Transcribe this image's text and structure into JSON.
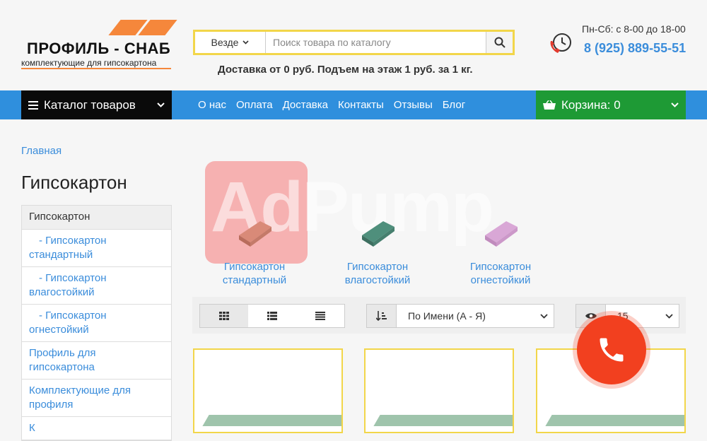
{
  "logo": {
    "title": "ПРОФИЛЬ - СНАБ",
    "subtitle": "комплектующие для гипсокартона"
  },
  "search": {
    "scope": "Везде",
    "placeholder": "Поиск товара по каталогу"
  },
  "delivery_text": "Доставка от 0 руб. Подъем на этаж 1 руб. за 1 кг.",
  "contacts": {
    "hours": "Пн-Сб: с 8-00 до 18-00",
    "phone": "8 (925) 889-55-51"
  },
  "nav": {
    "catalog_label": "Каталог товаров",
    "links": [
      "О нас",
      "Оплата",
      "Доставка",
      "Контакты",
      "Отзывы",
      "Блог"
    ],
    "cart_label": "Корзина: 0"
  },
  "breadcrumb": "Главная",
  "page_title": "Гипсокартон",
  "sidebar": {
    "header": "Гипсокартон",
    "items": [
      "- Гипсокартон стандартный",
      "- Гипсокартон влагостойкий",
      "- Гипсокартон огнестойкий",
      "Профиль для гипсокартона",
      "Комплектующие для профиля",
      "К"
    ]
  },
  "categories": [
    {
      "label": "Гипсокартон стандартный",
      "color": "#d98a78"
    },
    {
      "label": "Гипсокартон влагостойкий",
      "color": "#4f8f7c"
    },
    {
      "label": "Гипсокартон огнестойкий",
      "color": "#d9a7d6"
    }
  ],
  "watermark": "AdPump",
  "toolbar": {
    "sort_value": "По Имени (А - Я)",
    "show_value": "15"
  },
  "colors": {
    "accent": "#2f8fdd",
    "cart": "#1e9a35",
    "highlight": "#f2d64a",
    "call": "#f2401f",
    "logo_orange": "#f5873b"
  }
}
